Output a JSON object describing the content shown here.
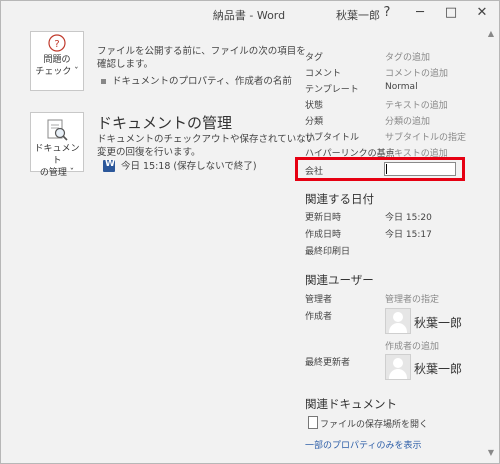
{
  "titlebar": {
    "title": "納品書 - Word",
    "user": "秋葉一郎",
    "help": "?",
    "minimize": "─",
    "maximize": "□",
    "close": "✕"
  },
  "inspect": {
    "tile_label_1": "問題の",
    "tile_label_2": "チェック ˇ",
    "desc_line1": "ファイルを公開する前に、ファイルの次の項目を",
    "desc_line2": "確認します。",
    "bullet": "ドキュメントのプロパティ、作成者の名前"
  },
  "manage": {
    "heading": "ドキュメントの管理",
    "tile_label_1": "ドキュメント",
    "tile_label_2": "の管理 ˇ",
    "desc_line1": "ドキュメントのチェックアウトや保存されていない",
    "desc_line2": "変更の回復を行います。",
    "version_entry": "今日 15:18 (保存しないで終了)"
  },
  "properties": {
    "rows": [
      {
        "label": "タグ",
        "value": "タグの追加"
      },
      {
        "label": "コメント",
        "value": "コメントの追加"
      },
      {
        "label": "テンプレート",
        "value": "Normal"
      },
      {
        "label": "状態",
        "value": "テキストの追加"
      },
      {
        "label": "分類",
        "value": "分類の追加"
      },
      {
        "label": "サブタイトル",
        "value": "サブタイトルの指定"
      },
      {
        "label": "ハイパーリンクの基点",
        "value": "テキストの追加"
      }
    ],
    "company_label": "会社",
    "company_value": ""
  },
  "dates": {
    "heading": "関連する日付",
    "rows": [
      {
        "label": "更新日時",
        "value": "今日 15:20"
      },
      {
        "label": "作成日時",
        "value": "今日 15:17"
      },
      {
        "label": "最終印刷日",
        "value": ""
      }
    ]
  },
  "people": {
    "heading": "関連ユーザー",
    "manager_label": "管理者",
    "manager_value": "管理者の指定",
    "author_label": "作成者",
    "author_name": "秋葉一郎",
    "add_author": "作成者の追加",
    "last_modified_label": "最終更新者",
    "last_modified_name": "秋葉一郎"
  },
  "documents": {
    "heading": "関連ドキュメント",
    "open_location": "ファイルの保存場所を開く",
    "show_fewer": "一部のプロパティのみを表示"
  }
}
